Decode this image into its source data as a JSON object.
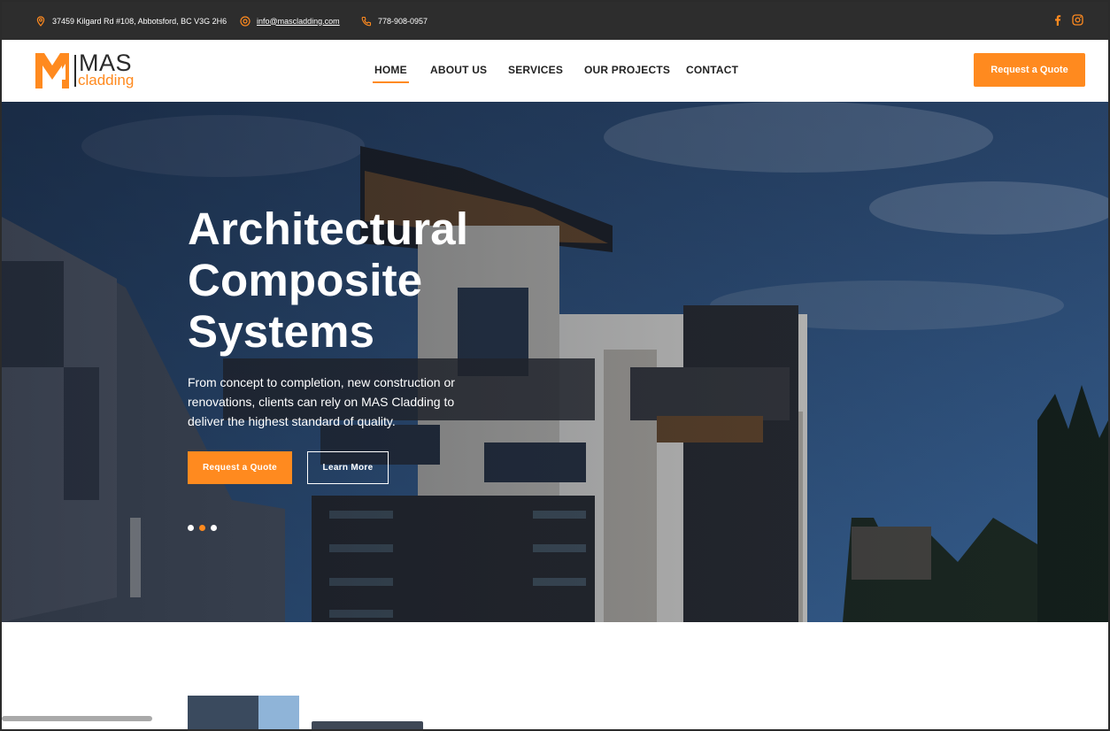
{
  "topbar": {
    "address": "37459 Kilgard Rd #108, Abbotsford, BC V3G 2H6",
    "email": "info@mascladding.com",
    "phone": "778-908-0957",
    "icons": {
      "address": "map-pin-icon",
      "email": "at-icon",
      "phone": "phone-icon",
      "facebook": "facebook-icon",
      "instagram": "instagram-icon"
    }
  },
  "logo": {
    "brand": "MAS",
    "sub": "cladding"
  },
  "nav": {
    "items": [
      {
        "label": "HOME",
        "active": true
      },
      {
        "label": "ABOUT US",
        "active": false
      },
      {
        "label": "SERVICES",
        "active": false
      },
      {
        "label": "OUR PROJECTS",
        "active": false
      },
      {
        "label": "CONTACT",
        "active": false
      }
    ],
    "cta": "Request a Quote"
  },
  "hero": {
    "title": "Architectural Composite Systems",
    "text": "From concept to completion, new construction or renovations, clients can rely on MAS Cladding to deliver the highest standard of quality.",
    "primary_button": "Request a Quote",
    "secondary_button": "Learn More",
    "slides": {
      "count": 3,
      "active_index": 1
    }
  },
  "colors": {
    "accent": "#ff8a1f",
    "topbar": "#2d2d2d",
    "text_dark": "#222222"
  }
}
